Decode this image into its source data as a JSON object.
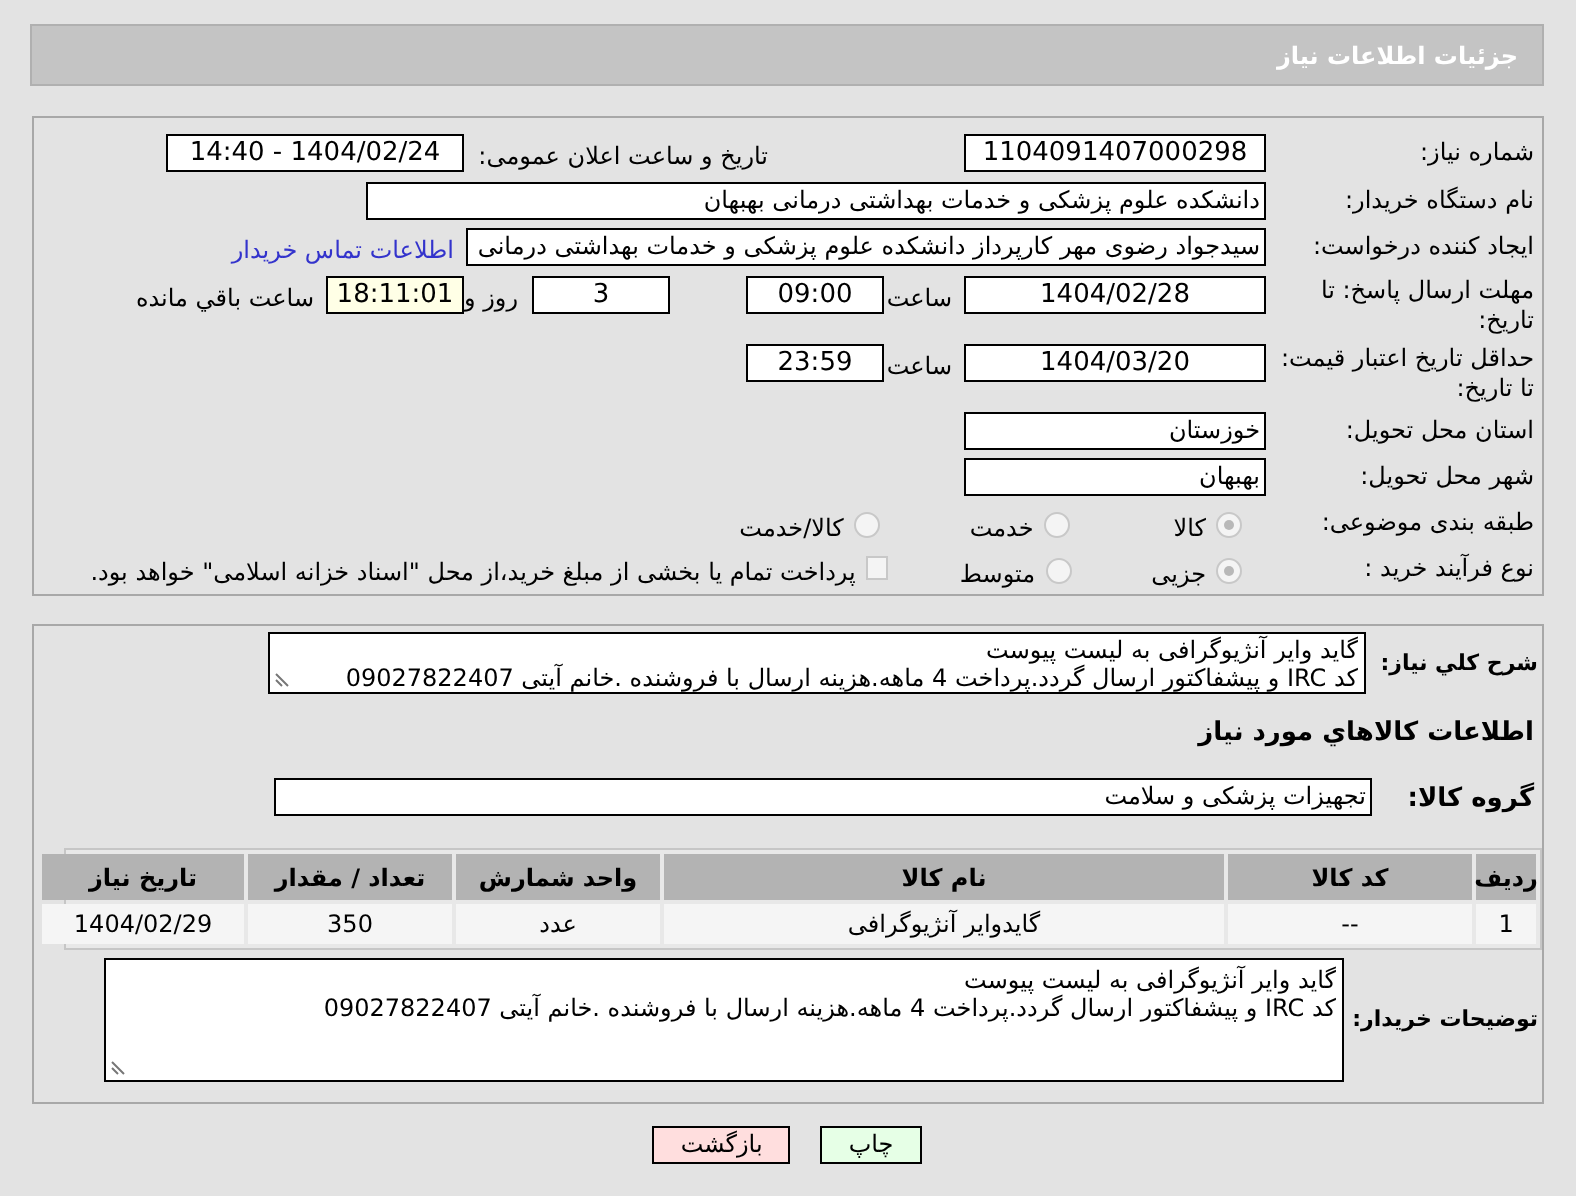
{
  "header": {
    "title": "جزئیات اطلاعات نیاز"
  },
  "need_number": {
    "label": "شماره نیاز:",
    "value": "1104091407000298"
  },
  "announce": {
    "label": "تاریخ و ساعت اعلان عمومی:",
    "value": "1404/02/24 - 14:40"
  },
  "buyer_org": {
    "label": "نام دستگاه خریدار:",
    "value": "دانشکده علوم پزشکی و خدمات بهداشتی  درمانی بهبهان"
  },
  "requester": {
    "label": "ایجاد کننده درخواست:",
    "value": "سیدجواد رضوی مهر کارپرداز دانشکده علوم پزشکی و خدمات بهداشتی  درمانی",
    "link": "اطلاعات تماس خریدار"
  },
  "reply_deadline": {
    "label": "مهلت ارسال پاسخ: تا تاریخ:",
    "date": "1404/02/28",
    "time_label": "ساعت",
    "time": "09:00",
    "days": "3",
    "days_label": "روز و",
    "remaining": "18:11:01",
    "remaining_label": "ساعت باقي مانده"
  },
  "price_validity": {
    "label": "حداقل تاریخ اعتبار قیمت: تا تاریخ:",
    "date": "1404/03/20",
    "time_label": "ساعت",
    "time": "23:59"
  },
  "province": {
    "label": "استان محل تحویل:",
    "value": "خوزستان"
  },
  "city": {
    "label": "شهر محل تحویل:",
    "value": "بهبهان"
  },
  "category": {
    "label": "طبقه بندی موضوعی:",
    "options": [
      {
        "label": "کالا",
        "selected": true
      },
      {
        "label": "خدمت",
        "selected": false
      },
      {
        "label": "کالا/خدمت",
        "selected": false
      }
    ]
  },
  "process": {
    "label": "نوع فرآیند خرید :",
    "options": [
      {
        "label": "جزیی",
        "selected": true
      },
      {
        "label": "متوسط",
        "selected": false
      }
    ],
    "payment": {
      "checked": false,
      "label": "پرداخت تمام یا بخشی از مبلغ خرید،از محل \"اسناد خزانه اسلامی\" خواهد بود."
    }
  },
  "description": {
    "label": "شرح کلي نياز:",
    "lines": [
      "گاید وایر آنژیوگرافی به لیست پیوست",
      "کد IRC و پیشفاکتور ارسال گردد.پرداخت 4 ماهه.هزینه ارسال با فروشنده .خانم آیتی 09027822407"
    ]
  },
  "goods_heading": "اطلاعات کالاهاي مورد نياز",
  "goods_group": {
    "label": "گروه کالا:",
    "value": "تجهیزات پزشکی و سلامت"
  },
  "table": {
    "columns": [
      "ردیف",
      "کد کالا",
      "نام کالا",
      "واحد شمارش",
      "تعداد / مقدار",
      "تاریخ نیاز"
    ],
    "rows": [
      [
        "1",
        "--",
        "گایدوایر آنژیوگرافی",
        "عدد",
        "350",
        "1404/02/29"
      ]
    ]
  },
  "buyer_notes": {
    "label": "توضیحات خریدار:",
    "lines": [
      "گاید وایر آنژیوگرافی به لیست پیوست",
      "کد IRC و پیشفاکتور ارسال گردد.پرداخت 4 ماهه.هزینه ارسال با فروشنده .خانم آیتی 09027822407"
    ]
  },
  "buttons": [
    {
      "kind": "print",
      "label": "چاپ"
    },
    {
      "kind": "back",
      "label": "بازگشت"
    }
  ]
}
